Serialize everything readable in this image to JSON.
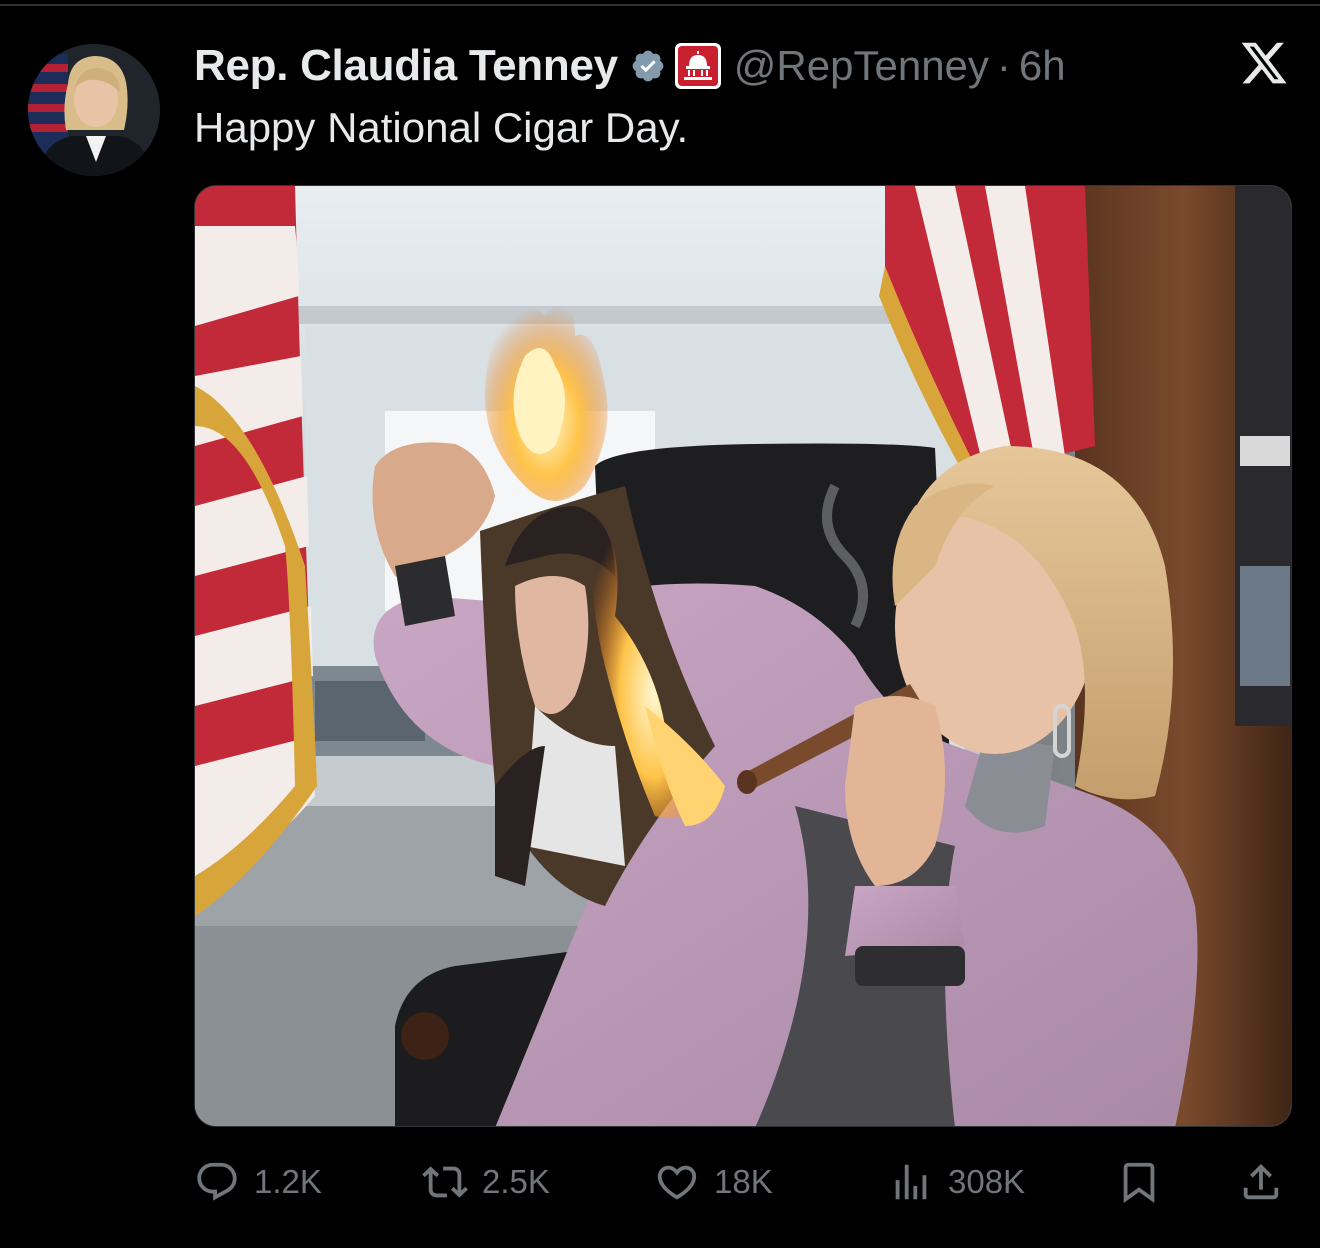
{
  "author": {
    "display_name": "Rep. Claudia Tenney",
    "handle": "@RepTenney",
    "time_separator": "·",
    "time": "6h",
    "verified_badge_icon": "verified-badge-icon",
    "affiliate_badge_icon": "house-gop-capitol-icon"
  },
  "tweet": {
    "text": "Happy National Cigar Day.",
    "media_description_icon": "photo"
  },
  "actions": {
    "reply_count": "1.2K",
    "retweet_count": "2.5K",
    "like_count": "18K",
    "views_count": "308K"
  },
  "colors": {
    "background": "#000000",
    "text_primary": "#e7e9ea",
    "text_secondary": "#71767b",
    "verified_blue": "#1d9bf0",
    "affiliate_red": "#c8202f"
  }
}
